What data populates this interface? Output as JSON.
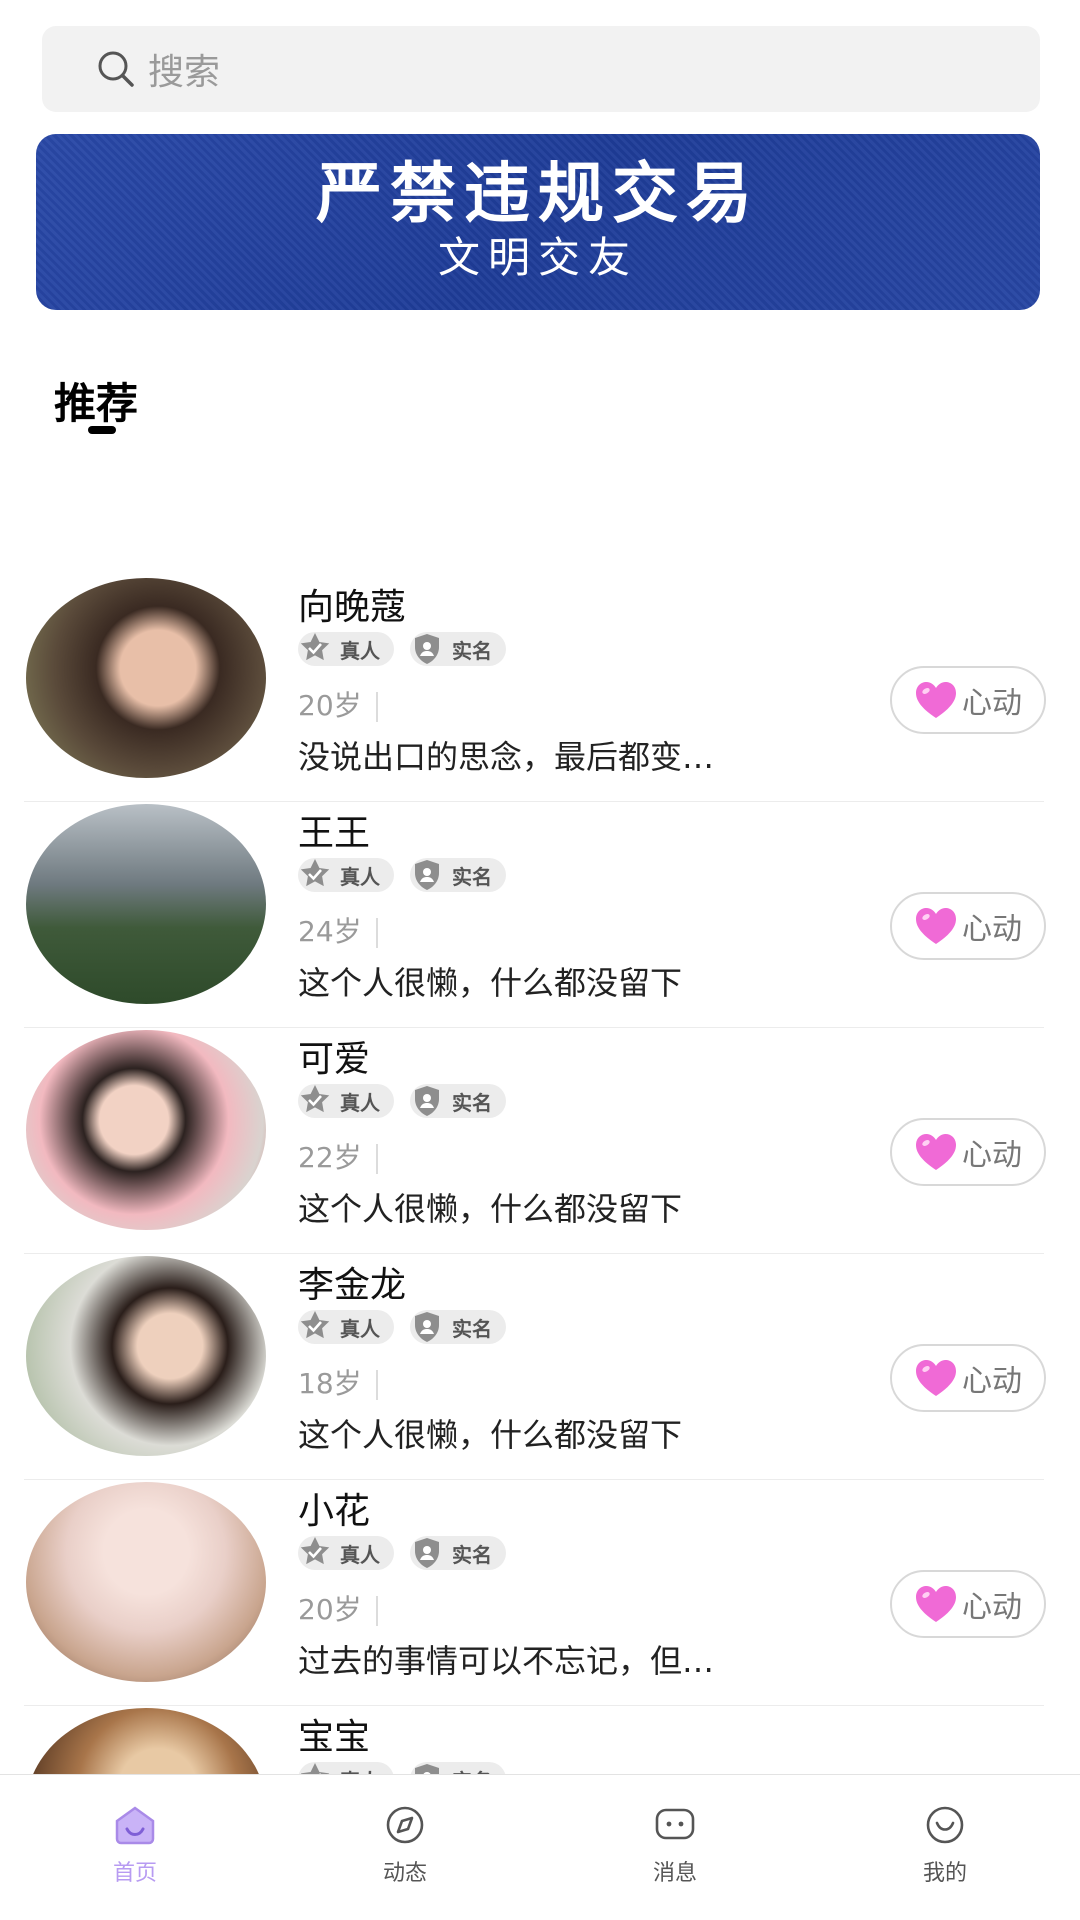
{
  "search": {
    "placeholder": "搜索"
  },
  "banner": {
    "title": "严禁违规交易",
    "subtitle": "文明交友"
  },
  "section": {
    "title": "推荐"
  },
  "badges": {
    "real_person": "真人",
    "real_name": "实名"
  },
  "like_label": "心动",
  "users": [
    {
      "name": "向晚蔻",
      "age": "20岁",
      "bio": "没说出口的思念，最后都变…"
    },
    {
      "name": "王王",
      "age": "24岁",
      "bio": "这个人很懒，什么都没留下"
    },
    {
      "name": "可爱",
      "age": "22岁",
      "bio": "这个人很懒，什么都没留下"
    },
    {
      "name": "李金龙",
      "age": "18岁",
      "bio": "这个人很懒，什么都没留下"
    },
    {
      "name": "小花",
      "age": "20岁",
      "bio": "过去的事情可以不忘记，但…"
    },
    {
      "name": "宝宝",
      "age": "",
      "bio": ""
    }
  ],
  "tabs": [
    {
      "label": "首页",
      "icon": "home-icon",
      "active": true
    },
    {
      "label": "动态",
      "icon": "compass-icon",
      "active": false
    },
    {
      "label": "消息",
      "icon": "message-icon",
      "active": false
    },
    {
      "label": "我的",
      "icon": "smile-icon",
      "active": false
    }
  ],
  "colors": {
    "accent": "#b79bf2",
    "heart": "#f06ad6",
    "banner": "#2343a0"
  }
}
